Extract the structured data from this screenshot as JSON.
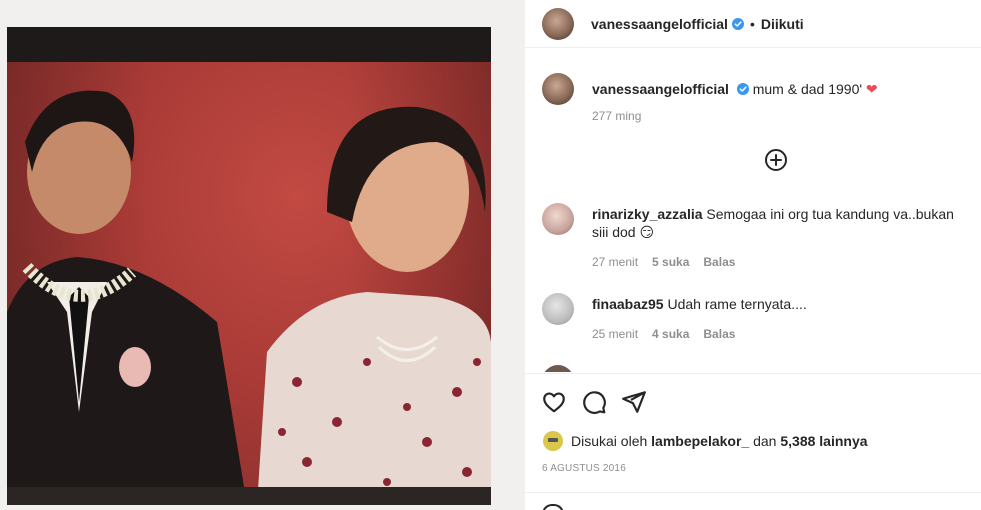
{
  "header": {
    "username": "vanessaangelofficial",
    "separator": "•",
    "follow_status": "Diikuti"
  },
  "caption": {
    "username": "vanessaangelofficial",
    "text": "mum & dad 1990'",
    "emoji": "❤",
    "time": "277 ming"
  },
  "comments": [
    {
      "username": "rinarizky_azzalia",
      "text": "Semogaa ini org tua kandung va..bukan siii dod",
      "emoji": "😏",
      "time": "27 menit",
      "likes": "5 suka",
      "reply": "Balas"
    },
    {
      "username": "finaabaz95",
      "text": "Udah rame ternyata....",
      "time": "25 menit",
      "likes": "4 suka",
      "reply": "Balas"
    }
  ],
  "likes": {
    "prefix": "Disukai oleh",
    "user": "lambepelakor_",
    "middle": "dan",
    "count": "5,388 lainnya"
  },
  "date": "6 AGUSTUS 2016",
  "colors": {
    "verified": "#3897f0",
    "heart": "#ed4956",
    "muted": "#8e8e8e",
    "text": "#262626"
  },
  "icons": [
    "verified-icon",
    "add-comment-icon",
    "heart-icon",
    "comment-icon",
    "share-icon"
  ]
}
